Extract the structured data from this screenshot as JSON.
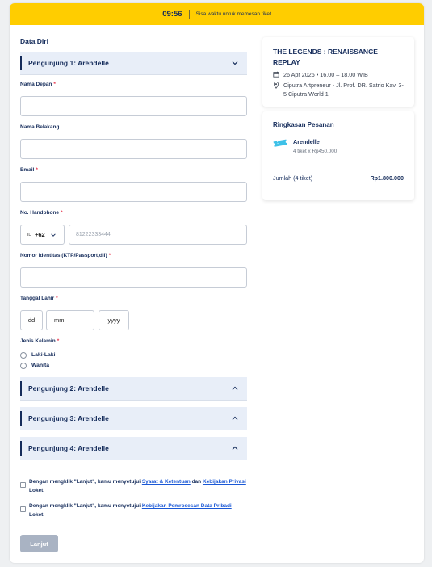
{
  "timer": {
    "time": "09:56",
    "message": "Sisa waktu untuk memesan tiket"
  },
  "form": {
    "section_title": "Data Diri",
    "visitor1": "Pengunjung 1: Arendelle",
    "first_name_label": "Nama Depan",
    "last_name_label": "Nama Belakang",
    "email_label": "Email",
    "phone_label": "No. Handphone",
    "country_flag": "ID",
    "country_code": "+62",
    "phone_placeholder": "81222333444",
    "id_label": "Nomor Identitas (KTP/Passport,dll)",
    "dob_label": "Tanggal Lahir",
    "dob_day": "dd",
    "dob_month": "mm",
    "dob_year": "yyyy",
    "gender_label": "Jenis Kelamin",
    "gender_options": [
      "Laki-Laki",
      "Wanita"
    ],
    "visitor2": "Pengunjung 2: Arendelle",
    "visitor3": "Pengunjung 3: Arendelle",
    "visitor4": "Pengunjung 4: Arendelle",
    "agree1": {
      "prefix": "Dengan mengklik \"Lanjut\", kamu menyetujui ",
      "link1": "Syarat & Ketentuan",
      "mid": " dan ",
      "link2": "Kebijakan Privasi",
      "suffix": " Loket."
    },
    "agree2": {
      "prefix": "Dengan mengklik \"Lanjut\", kamu menyetujui ",
      "link1": "Kebijakan Pemrosesan Data Pribadi",
      "suffix": " Loket."
    },
    "submit": "Lanjut"
  },
  "event": {
    "title": "THE LEGENDS : RENAISSANCE REPLAY",
    "date": "26 Apr 2026 • 16.00 – 18.00 WIB",
    "location": "Ciputra Artpreneur - Jl. Prof. DR. Satrio Kav. 3-5 Ciputra World 1"
  },
  "summary": {
    "title": "Ringkasan Pesanan",
    "item_name": "Arendelle",
    "item_qty": "4 tiket x Rp450.000",
    "total_label": "Jumlah (4 tiket)",
    "total_value": "Rp1.800.000"
  },
  "colors": {
    "timer_bg": "#ffcd00",
    "navy": "#152c5b",
    "accent_blue": "#1a58d6",
    "required": "#e8384f",
    "ticket_icon": "#3ec1e8"
  }
}
